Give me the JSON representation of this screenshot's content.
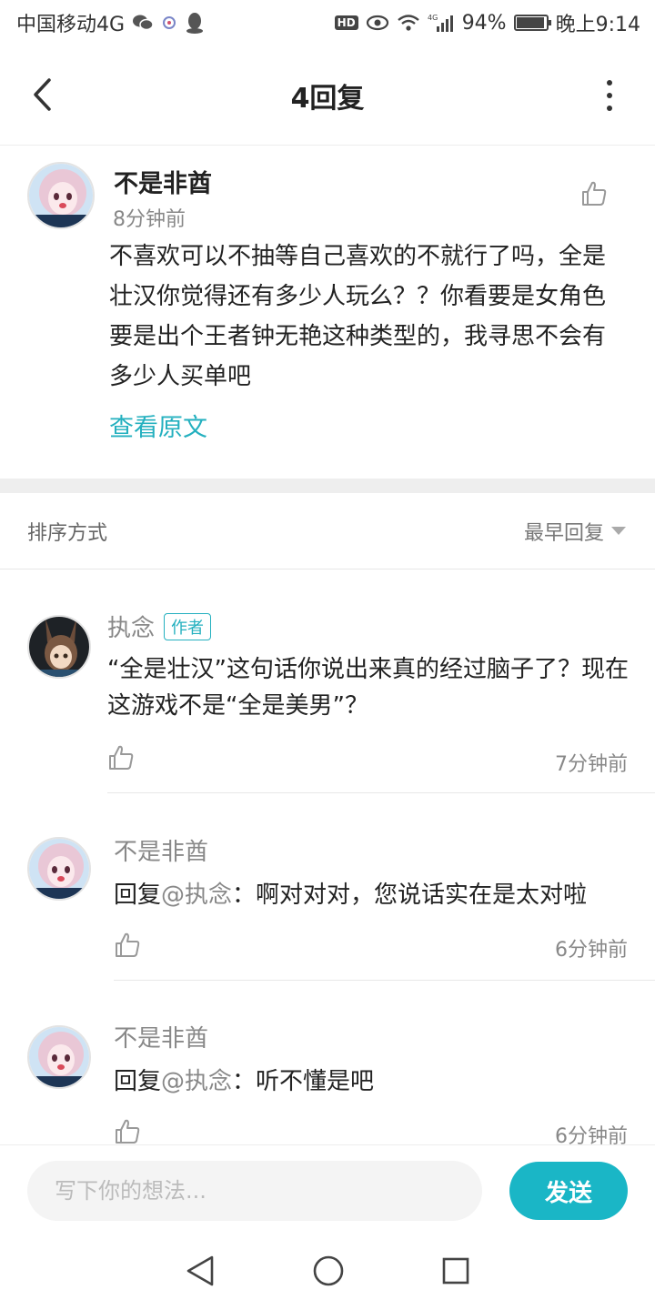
{
  "statusbar": {
    "carrier": "中国移动4G",
    "network": "4G",
    "battery": "94%",
    "battery_level": 0.94,
    "time": "晚上9:14"
  },
  "header": {
    "title": "4回复"
  },
  "post": {
    "author": "不是非酋",
    "time": "8分钟前",
    "text": "不喜欢可以不抽等自己喜欢的不就行了吗，全是壮汉你觉得还有多少人玩么？？你看要是女角色要是出个王者钟无艳这种类型的，我寻思不会有多少人买单吧",
    "view_original": "查看原文"
  },
  "sort": {
    "label": "排序方式",
    "selected": "最早回复"
  },
  "replies": [
    {
      "author": "执念",
      "badge": "作者",
      "prefix": "",
      "mention": "",
      "text": "“全是壮汉”这句话你说出来真的经过脑子了？现在这游戏不是“全是美男”？",
      "time": "7分钟前"
    },
    {
      "author": "不是非酋",
      "badge": "",
      "prefix": "回复",
      "mention": "@执念",
      "text": "：啊对对对，您说话实在是太对啦",
      "time": "6分钟前"
    },
    {
      "author": "不是非酋",
      "badge": "",
      "prefix": "回复",
      "mention": "@执念",
      "text": "：听不懂是吧",
      "time": "6分钟前"
    }
  ],
  "composer": {
    "placeholder": "写下你的想法...",
    "send_label": "发送"
  },
  "colors": {
    "accent": "#1ab6c6",
    "link": "#24b0bf"
  }
}
